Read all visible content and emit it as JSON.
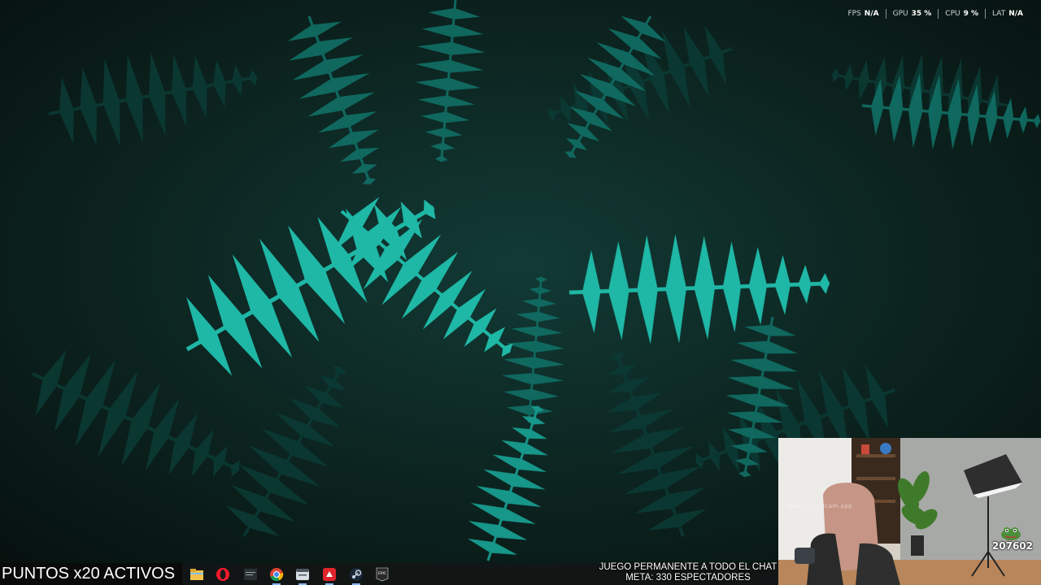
{
  "perf_overlay": {
    "items": [
      {
        "label": "FPS",
        "value": "N/A"
      },
      {
        "label": "GPU",
        "value": "35 %"
      },
      {
        "label": "CPU",
        "value": "9 %"
      },
      {
        "label": "LAT",
        "value": "N/A"
      }
    ]
  },
  "stream_overlay": {
    "points_banner": "PUNTOS x20 ACTIVOS",
    "goal_line1": "JUEGO PERMANENTE A TODO EL CHAT",
    "goal_line2": "META: 330 ESPECTADORES",
    "webcam_watermark": "usa______ldcam.app",
    "webcam_counter": "207602"
  },
  "taskbar": {
    "icons": [
      {
        "name": "file-explorer-icon",
        "color": "#f2c14e"
      },
      {
        "name": "opera-icon",
        "color": "#ff1b2d"
      },
      {
        "name": "cmd-app-icon",
        "color": "#2a2f33"
      },
      {
        "name": "chrome-icon",
        "color": "#4285f4"
      },
      {
        "name": "window-app-icon",
        "color": "#d8dde3"
      },
      {
        "name": "red-app-icon",
        "color": "#e0242c"
      },
      {
        "name": "steam-icon",
        "color": "#1b2838"
      },
      {
        "name": "epic-games-icon",
        "color": "#2a2a2a"
      }
    ],
    "epic_label": "EPIC"
  },
  "colors": {
    "wallpaper_base": "#0a1512",
    "fern_bright": "#1fb7a6",
    "fern_dark": "#0d4a44"
  }
}
